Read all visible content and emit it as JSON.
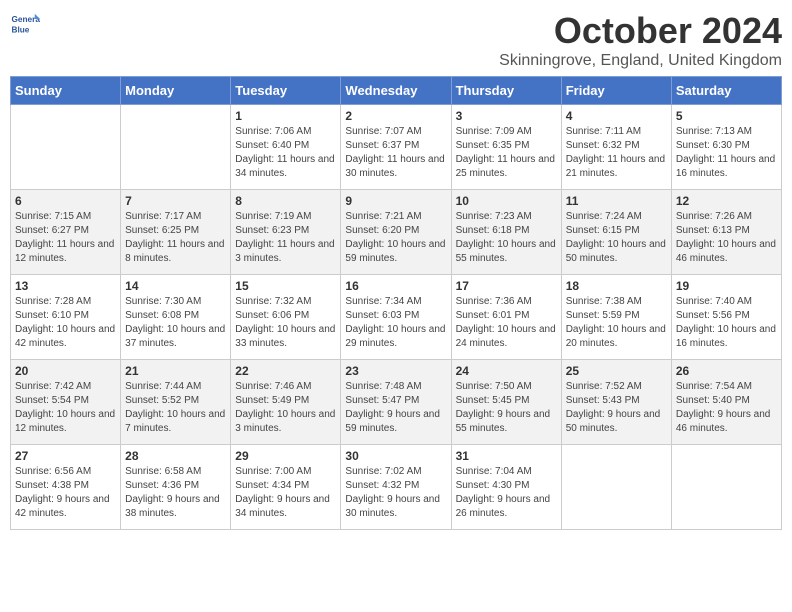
{
  "header": {
    "logo_line1": "General",
    "logo_line2": "Blue",
    "title": "October 2024",
    "subtitle": "Skinningrove, England, United Kingdom"
  },
  "days_of_week": [
    "Sunday",
    "Monday",
    "Tuesday",
    "Wednesday",
    "Thursday",
    "Friday",
    "Saturday"
  ],
  "weeks": [
    [
      {
        "num": "",
        "info": ""
      },
      {
        "num": "",
        "info": ""
      },
      {
        "num": "1",
        "info": "Sunrise: 7:06 AM\nSunset: 6:40 PM\nDaylight: 11 hours and 34 minutes."
      },
      {
        "num": "2",
        "info": "Sunrise: 7:07 AM\nSunset: 6:37 PM\nDaylight: 11 hours and 30 minutes."
      },
      {
        "num": "3",
        "info": "Sunrise: 7:09 AM\nSunset: 6:35 PM\nDaylight: 11 hours and 25 minutes."
      },
      {
        "num": "4",
        "info": "Sunrise: 7:11 AM\nSunset: 6:32 PM\nDaylight: 11 hours and 21 minutes."
      },
      {
        "num": "5",
        "info": "Sunrise: 7:13 AM\nSunset: 6:30 PM\nDaylight: 11 hours and 16 minutes."
      }
    ],
    [
      {
        "num": "6",
        "info": "Sunrise: 7:15 AM\nSunset: 6:27 PM\nDaylight: 11 hours and 12 minutes."
      },
      {
        "num": "7",
        "info": "Sunrise: 7:17 AM\nSunset: 6:25 PM\nDaylight: 11 hours and 8 minutes."
      },
      {
        "num": "8",
        "info": "Sunrise: 7:19 AM\nSunset: 6:23 PM\nDaylight: 11 hours and 3 minutes."
      },
      {
        "num": "9",
        "info": "Sunrise: 7:21 AM\nSunset: 6:20 PM\nDaylight: 10 hours and 59 minutes."
      },
      {
        "num": "10",
        "info": "Sunrise: 7:23 AM\nSunset: 6:18 PM\nDaylight: 10 hours and 55 minutes."
      },
      {
        "num": "11",
        "info": "Sunrise: 7:24 AM\nSunset: 6:15 PM\nDaylight: 10 hours and 50 minutes."
      },
      {
        "num": "12",
        "info": "Sunrise: 7:26 AM\nSunset: 6:13 PM\nDaylight: 10 hours and 46 minutes."
      }
    ],
    [
      {
        "num": "13",
        "info": "Sunrise: 7:28 AM\nSunset: 6:10 PM\nDaylight: 10 hours and 42 minutes."
      },
      {
        "num": "14",
        "info": "Sunrise: 7:30 AM\nSunset: 6:08 PM\nDaylight: 10 hours and 37 minutes."
      },
      {
        "num": "15",
        "info": "Sunrise: 7:32 AM\nSunset: 6:06 PM\nDaylight: 10 hours and 33 minutes."
      },
      {
        "num": "16",
        "info": "Sunrise: 7:34 AM\nSunset: 6:03 PM\nDaylight: 10 hours and 29 minutes."
      },
      {
        "num": "17",
        "info": "Sunrise: 7:36 AM\nSunset: 6:01 PM\nDaylight: 10 hours and 24 minutes."
      },
      {
        "num": "18",
        "info": "Sunrise: 7:38 AM\nSunset: 5:59 PM\nDaylight: 10 hours and 20 minutes."
      },
      {
        "num": "19",
        "info": "Sunrise: 7:40 AM\nSunset: 5:56 PM\nDaylight: 10 hours and 16 minutes."
      }
    ],
    [
      {
        "num": "20",
        "info": "Sunrise: 7:42 AM\nSunset: 5:54 PM\nDaylight: 10 hours and 12 minutes."
      },
      {
        "num": "21",
        "info": "Sunrise: 7:44 AM\nSunset: 5:52 PM\nDaylight: 10 hours and 7 minutes."
      },
      {
        "num": "22",
        "info": "Sunrise: 7:46 AM\nSunset: 5:49 PM\nDaylight: 10 hours and 3 minutes."
      },
      {
        "num": "23",
        "info": "Sunrise: 7:48 AM\nSunset: 5:47 PM\nDaylight: 9 hours and 59 minutes."
      },
      {
        "num": "24",
        "info": "Sunrise: 7:50 AM\nSunset: 5:45 PM\nDaylight: 9 hours and 55 minutes."
      },
      {
        "num": "25",
        "info": "Sunrise: 7:52 AM\nSunset: 5:43 PM\nDaylight: 9 hours and 50 minutes."
      },
      {
        "num": "26",
        "info": "Sunrise: 7:54 AM\nSunset: 5:40 PM\nDaylight: 9 hours and 46 minutes."
      }
    ],
    [
      {
        "num": "27",
        "info": "Sunrise: 6:56 AM\nSunset: 4:38 PM\nDaylight: 9 hours and 42 minutes."
      },
      {
        "num": "28",
        "info": "Sunrise: 6:58 AM\nSunset: 4:36 PM\nDaylight: 9 hours and 38 minutes."
      },
      {
        "num": "29",
        "info": "Sunrise: 7:00 AM\nSunset: 4:34 PM\nDaylight: 9 hours and 34 minutes."
      },
      {
        "num": "30",
        "info": "Sunrise: 7:02 AM\nSunset: 4:32 PM\nDaylight: 9 hours and 30 minutes."
      },
      {
        "num": "31",
        "info": "Sunrise: 7:04 AM\nSunset: 4:30 PM\nDaylight: 9 hours and 26 minutes."
      },
      {
        "num": "",
        "info": ""
      },
      {
        "num": "",
        "info": ""
      }
    ]
  ]
}
